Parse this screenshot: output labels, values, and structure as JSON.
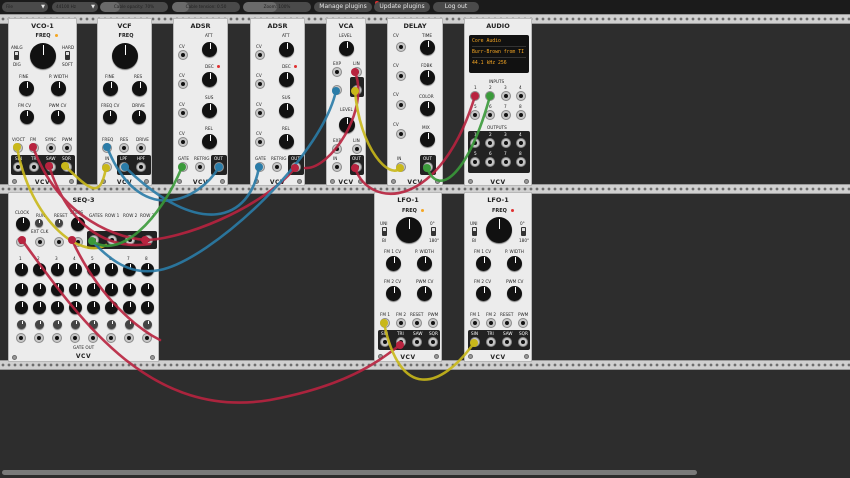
{
  "toolbar": {
    "file_menu": "File",
    "sample_rate": "44100 Hz",
    "cable_opacity": "Cable opacity: 70%",
    "cable_opacity_level": 0.3,
    "cable_tension": "Cable tension: 0.50",
    "cable_tension_level": 0.25,
    "zoom": "Zoom: 100%",
    "zoom_level": 0.5,
    "manage_plugins": "Manage plugins",
    "update_plugins": "Update plugins",
    "log_out": "Log out"
  },
  "brand": "VCV",
  "modules": {
    "vco": {
      "title": "VCO-1",
      "freq": "FREQ",
      "anlg": "ANLG",
      "dig": "DIG",
      "hard": "HARD",
      "soft": "SOFT",
      "fine": "FINE",
      "pwidth": "P. WIDTH",
      "fmcv": "FM CV",
      "pwmcv": "PWM CV",
      "in_voct": "V/OCT",
      "in_fm": "FM",
      "in_sync": "SYNC",
      "in_pwm": "PWM",
      "out_sin": "SIN",
      "out_tri": "TRI",
      "out_saw": "SAW",
      "out_sqr": "SQR"
    },
    "vcf": {
      "title": "VCF",
      "freq": "FREQ",
      "fine": "FINE",
      "res": "RES",
      "freqcv": "FREQ CV",
      "drive": "DRIVE",
      "in_freq": "FREQ",
      "in_res": "RES",
      "in_drive": "DRIVE",
      "in": "IN",
      "lpf": "LPF",
      "hpf": "HPF"
    },
    "adsr1": {
      "title": "ADSR",
      "cv": "CV",
      "att": "ATT",
      "dec": "DEC",
      "sus": "SUS",
      "rel": "REL",
      "gate": "GATE",
      "retrig": "RETRIG",
      "out": "OUT"
    },
    "adsr2": {
      "title": "ADSR",
      "cv": "CV",
      "att": "ATT",
      "dec": "DEC",
      "sus": "SUS",
      "rel": "REL",
      "gate": "GATE",
      "retrig": "RETRIG",
      "out": "OUT"
    },
    "vca": {
      "title": "VCA",
      "level": "LEVEL",
      "exp": "EXP",
      "lin": "LIN",
      "cv": "CV",
      "in": "IN",
      "out": "OUT"
    },
    "delay": {
      "title": "DELAY",
      "time": "TIME",
      "fdbk": "FDBK",
      "color": "COLOR",
      "mix": "MIX",
      "cv": "CV",
      "in": "IN",
      "out": "OUT"
    },
    "audio": {
      "title": "AUDIO",
      "lines": [
        "Core Audio",
        "Burr-Brown from TI",
        "44.1 kHz   256"
      ],
      "inputs": "INPUTS",
      "outputs": "OUTPUTS",
      "nums": [
        "1",
        "2",
        "3",
        "4",
        "5",
        "6",
        "7",
        "8"
      ]
    },
    "seq": {
      "title": "SEQ-3",
      "clock": "CLOCK",
      "run": "RUN",
      "reset": "RESET",
      "steps": "STEPS",
      "extclk": "EXT CLK",
      "gates": "GATES",
      "row1": "ROW 1",
      "row2": "ROW 2",
      "row3": "ROW 3",
      "gate_out": "GATE OUT",
      "step_nums": [
        "1",
        "2",
        "3",
        "4",
        "5",
        "6",
        "7",
        "8"
      ]
    },
    "lfo1": {
      "title": "LFO-1",
      "freq": "FREQ",
      "uni": "UNI",
      "bi": "BI",
      "pos0": "0°",
      "pos180": "180°",
      "fm1cv": "FM 1 CV",
      "pwidth": "P. WIDTH",
      "fm2cv": "FM 2 CV",
      "pwmcv": "PWM CV",
      "in_fm1": "FM 1",
      "in_fm2": "FM 2",
      "in_reset": "RESET",
      "in_pwm": "PWM",
      "out_sin": "SIN",
      "out_tri": "TRI",
      "out_saw": "SAW",
      "out_sqr": "SQR"
    },
    "lfo2": {
      "title": "LFO-1",
      "freq": "FREQ",
      "uni": "UNI",
      "bi": "BI",
      "pos0": "0°",
      "pos180": "180°",
      "fm1cv": "FM 1 CV",
      "pwidth": "P. WIDTH",
      "fm2cv": "FM 2 CV",
      "pwmcv": "PWM CV",
      "in_fm1": "FM 1",
      "in_fm2": "FM 2",
      "in_reset": "RESET",
      "in_pwm": "PWM",
      "out_sin": "SIN",
      "out_tri": "TRI",
      "out_saw": "SAW",
      "out_sqr": "SQR"
    }
  },
  "colors": {
    "cable_red": "#b8233f",
    "cable_yellow": "#c9b81a",
    "cable_blue": "#2a7ca8",
    "cable_green": "#3a9a3a",
    "led_red": "#e03030",
    "led_orange": "#f5a623",
    "display_text": "#f5a623"
  }
}
